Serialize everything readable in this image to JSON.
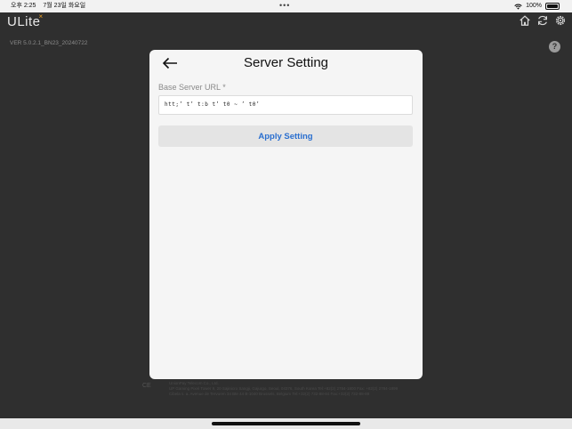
{
  "status_bar": {
    "time": "오후 2:25",
    "date": "7월 23일 화요일",
    "dots": "•••",
    "battery_percent": "100%"
  },
  "app": {
    "logo": "ULite",
    "logo_accent": "×",
    "version": "VER 5.0.2.1_BN23_20240722",
    "icons": [
      "home-icon",
      "refresh-icon",
      "settings-icon",
      "help-icon"
    ],
    "help_glyph": "?"
  },
  "modal": {
    "title": "Server Setting",
    "field_label": "Base Server URL *",
    "field_value": "htt;’ t’ t:b t’ t0 ~ ’ t0’",
    "apply_label": "Apply Setting"
  },
  "footer": {
    "ce": "CE",
    "lines": [
      "UnionPay Telecom Co., Ltd.",
      "UP Gaming Pixel Tower 9, 20 Sajinicro Sangji, Gajurgo, Seoul, 04376, South Korea Tel:+82(2) 2784-1800 Fax: +82(2) 2784-1899",
      "Cibela s. a. Avenue de Tervuren 34 Bte 44 B-1040 Brussels, Belgium Tel:+32(2) 732-88-84 Fax:+32(2) 732-88-89"
    ]
  },
  "colors": {
    "background": "#2f2f2f",
    "modal": "#f5f5f5",
    "accent": "#2a6fcf",
    "logo_accent": "#f0a020"
  }
}
